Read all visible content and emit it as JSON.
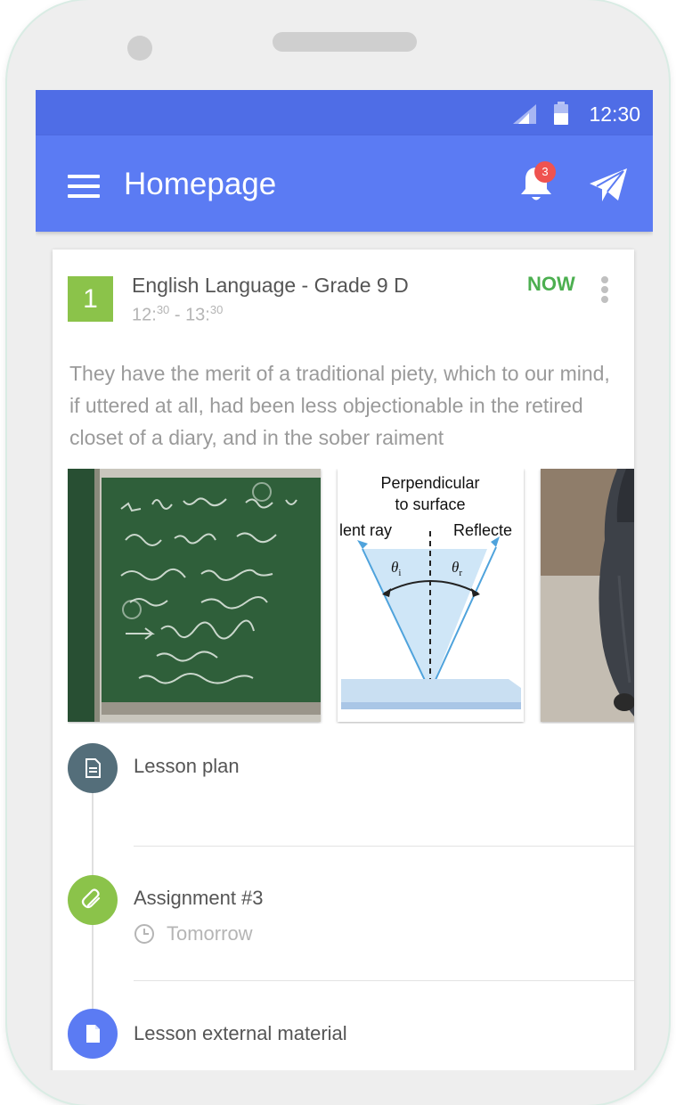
{
  "status_bar": {
    "time": "12:30"
  },
  "app_bar": {
    "title": "Homepage",
    "notification_count": "3"
  },
  "lesson": {
    "number": "1",
    "title": "English Language - Grade 9 D",
    "time_start_hour": "12:",
    "time_start_min": "30",
    "time_sep": " - ",
    "time_end_hour": "13:",
    "time_end_min": "30",
    "status": "NOW",
    "description": "They have the merit of a traditional piety, which to our mind, if uttered at all, had been less objectionable in the retired closet of a diary, and in the sober raiment"
  },
  "gallery": {
    "diagram_title_line1": "Perpendicular",
    "diagram_title_line2": "to surface",
    "diagram_left_label": "lent ray",
    "diagram_right_label": "Reflecte",
    "theta_i": "θ",
    "theta_i_sub": "i",
    "theta_r": "θ",
    "theta_r_sub": "r"
  },
  "timeline": {
    "items": [
      {
        "label": "Lesson plan"
      },
      {
        "label": "Assignment #3",
        "due": "Tomorrow"
      },
      {
        "label": "Lesson external material"
      }
    ]
  },
  "colors": {
    "status_bar": "#4f6de6",
    "app_bar": "#5b7bf3",
    "lesson_badge": "#8bc34a",
    "now": "#4caf50",
    "notification_badge": "#ef5350",
    "lesson_plan_circle": "#546e7a",
    "assignment_circle": "#8bc34a",
    "material_circle": "#5b7bf3"
  },
  "icons": [
    "signal-icon",
    "battery-icon",
    "menu-icon",
    "bell-icon",
    "send-icon",
    "more-icon",
    "document-icon",
    "paperclip-icon",
    "clock-icon",
    "file-icon"
  ]
}
